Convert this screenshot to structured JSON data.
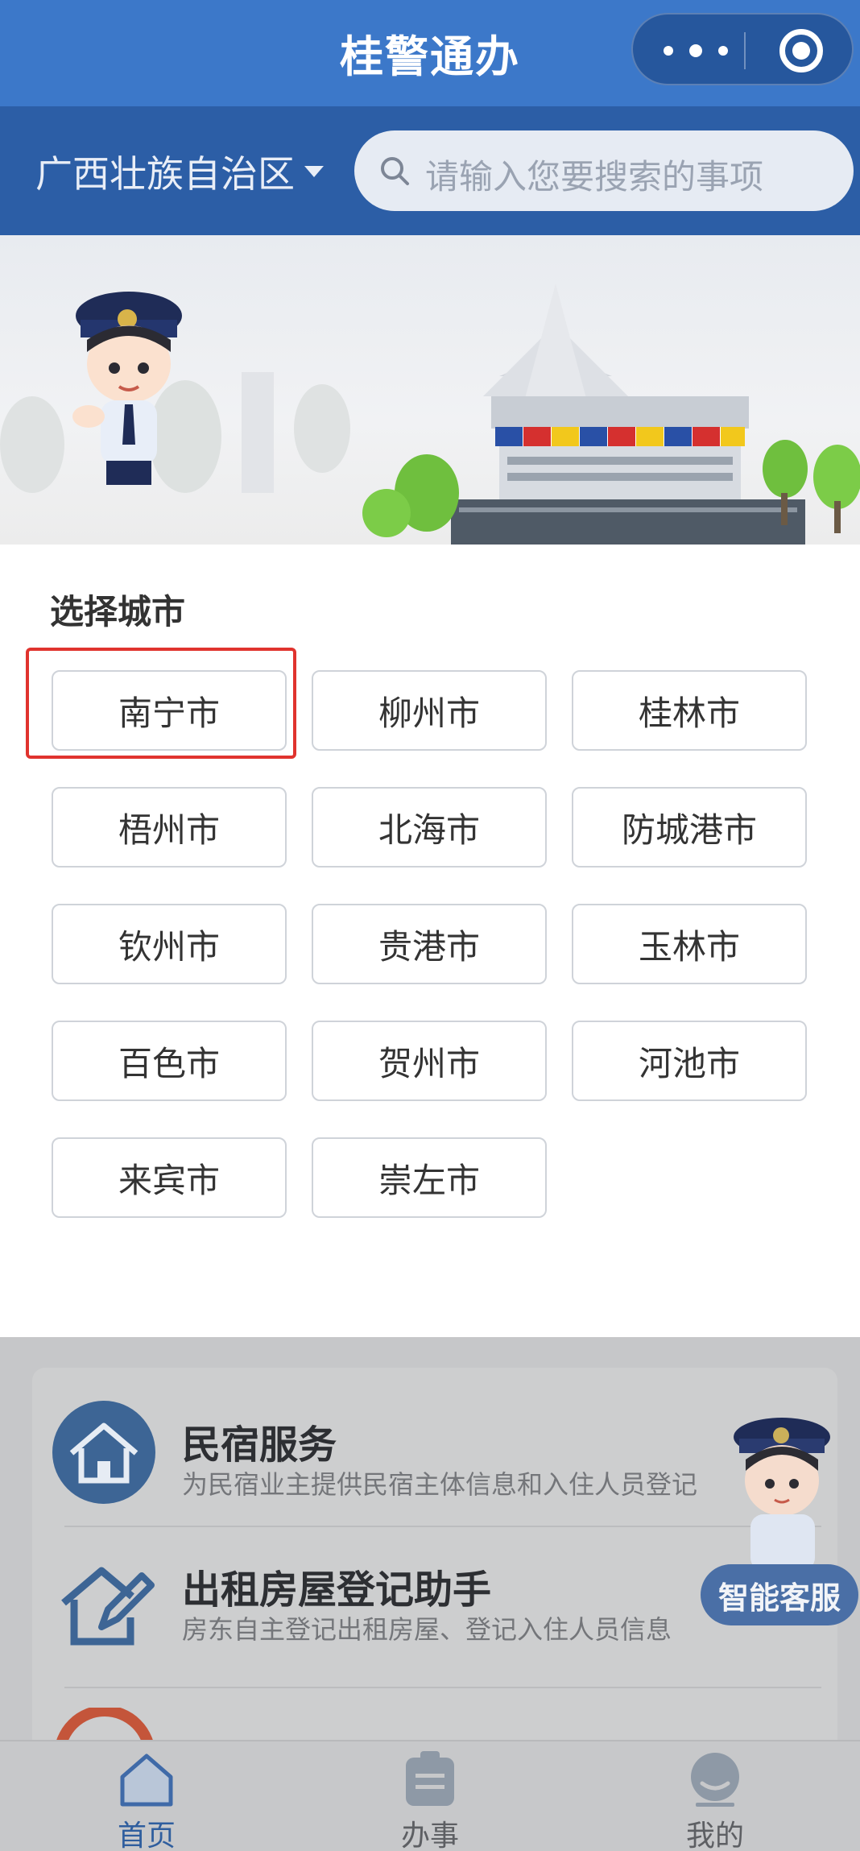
{
  "app": {
    "title": "桂警通办"
  },
  "header": {
    "region": "广西壮族自治区",
    "search_placeholder": "请输入您要搜索的事项",
    "more_icon": "more-dots-icon",
    "close_icon": "target-circle-icon"
  },
  "city_picker": {
    "title": "选择城市",
    "selected": "南宁市",
    "cities": [
      "南宁市",
      "柳州市",
      "桂林市",
      "梧州市",
      "北海市",
      "防城港市",
      "钦州市",
      "贵港市",
      "玉林市",
      "百色市",
      "贺州市",
      "河池市",
      "来宾市",
      "崇左市"
    ]
  },
  "services": {
    "section_title": "",
    "more": "",
    "items": [
      {
        "title": "民宿服务",
        "desc": "为民宿业主提供民宿主体信息和入住人员登记",
        "icon": "house-icon"
      },
      {
        "title": "出租房屋登记助手",
        "desc": "房东自主登记出租房屋、登记入住人员信息",
        "icon": "house-edit-icon"
      },
      {
        "title": "",
        "desc": "",
        "icon": "orange-circle-icon"
      }
    ]
  },
  "assistant": {
    "label": "智能客服"
  },
  "tabs": [
    {
      "label": "首页",
      "icon": "home-icon",
      "active": true
    },
    {
      "label": "办事",
      "icon": "clipboard-icon",
      "active": false
    },
    {
      "label": "我的",
      "icon": "user-icon",
      "active": false
    }
  ],
  "colors": {
    "brand": "#3c78c9",
    "brand_dark": "#2c5ea6",
    "highlight": "#e0332e"
  }
}
